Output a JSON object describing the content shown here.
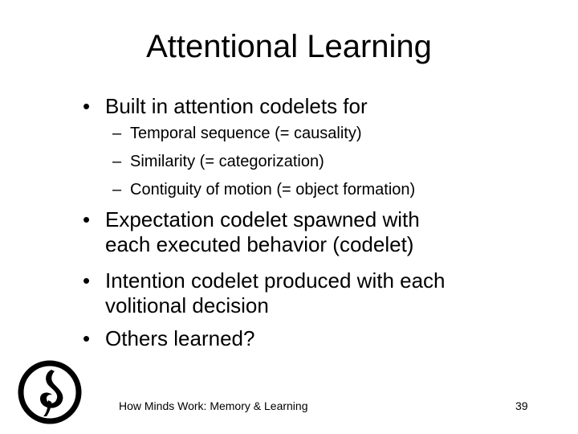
{
  "slide": {
    "title": "Attentional Learning",
    "bullet_marker": "•",
    "sub_marker": "–",
    "bullets": [
      {
        "text": "Built in attention codelets for",
        "sub": [
          "Temporal sequence (= causality)",
          "Similarity (= categorization)",
          "Contiguity of motion (= object formation)"
        ]
      },
      {
        "lines": [
          "Expectation codelet spawned with",
          "each executed behavior (codelet)"
        ]
      },
      {
        "lines": [
          "Intention codelet produced with each",
          "volitional decision"
        ]
      },
      {
        "text": "Others learned?"
      }
    ],
    "footer": "How Minds Work: Memory & Learning",
    "page_number": "39"
  }
}
